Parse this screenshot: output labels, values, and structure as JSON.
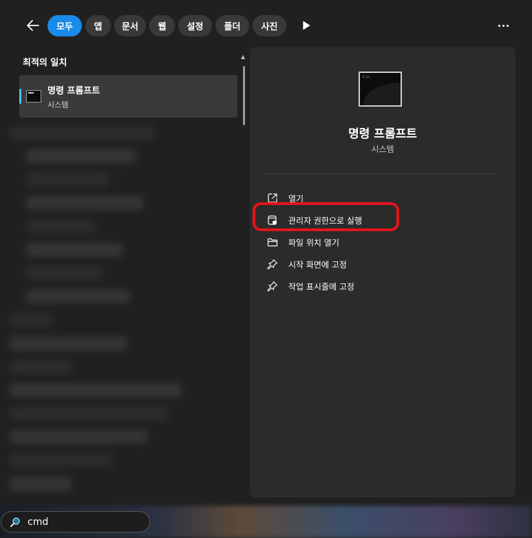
{
  "filters": {
    "items": [
      {
        "label": "모두",
        "active": true
      },
      {
        "label": "앱",
        "active": false
      },
      {
        "label": "문서",
        "active": false
      },
      {
        "label": "웹",
        "active": false
      },
      {
        "label": "설정",
        "active": false
      },
      {
        "label": "폴더",
        "active": false
      },
      {
        "label": "사진",
        "active": false
      }
    ]
  },
  "results": {
    "section_title": "최적의 일치",
    "best_match": {
      "title": "명령 프롬프트",
      "subtitle": "시스템",
      "icon": "cmd-icon"
    }
  },
  "details": {
    "app_name": "명령 프롬프트",
    "app_type": "시스템",
    "preview_prompt": "C:\\>_",
    "actions": [
      {
        "label": "열기",
        "icon": "open-external-icon"
      },
      {
        "label": "관리자 권한으로 실행",
        "icon": "shield-admin-icon"
      },
      {
        "label": "파일 위치 열기",
        "icon": "folder-icon"
      },
      {
        "label": "시작 화면에 고정",
        "icon": "pin-icon"
      },
      {
        "label": "작업 표시줄에 고정",
        "icon": "pin-icon"
      }
    ]
  },
  "search": {
    "value": "cmd"
  },
  "colors": {
    "accent": "#1a8be8",
    "highlight": "#e4141b",
    "selection_bar": "#4cc2ff"
  }
}
